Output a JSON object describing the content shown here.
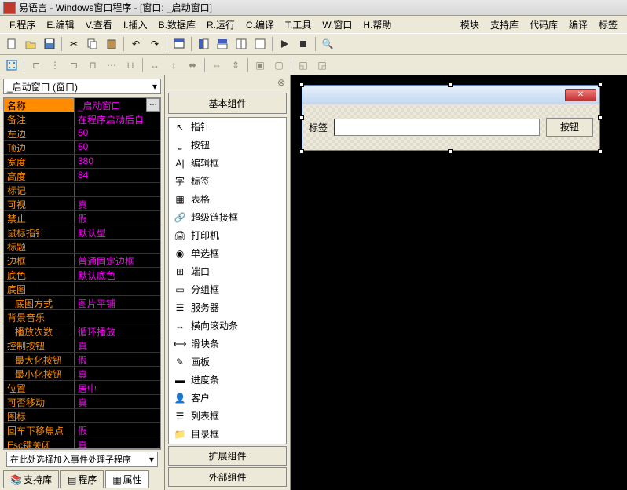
{
  "title": "易语言 - Windows窗口程序 - [窗口: _启动窗口]",
  "menu": {
    "left": [
      "F.程序",
      "E.编辑",
      "V.查看",
      "I.插入",
      "B.数据库",
      "R.运行",
      "C.编译",
      "T.工具",
      "W.窗口",
      "H.帮助"
    ],
    "right": [
      "模块",
      "支持库",
      "代码库",
      "编译",
      "标签"
    ]
  },
  "dropdown": "_启动窗口 (窗口)",
  "props": [
    {
      "name": "名称",
      "val": "_启动窗口",
      "sel": true,
      "btn": true
    },
    {
      "name": "备注",
      "val": "在程序启动后自"
    },
    {
      "name": "左边",
      "val": "50"
    },
    {
      "name": "顶边",
      "val": "50"
    },
    {
      "name": "宽度",
      "val": "380"
    },
    {
      "name": "高度",
      "val": "84"
    },
    {
      "name": "标记",
      "val": ""
    },
    {
      "name": "可视",
      "val": "真"
    },
    {
      "name": "禁止",
      "val": "假"
    },
    {
      "name": "鼠标指针",
      "val": "默认型"
    },
    {
      "name": "标题",
      "val": ""
    },
    {
      "name": "边框",
      "val": "普通固定边框"
    },
    {
      "name": "底色",
      "val": "默认底色"
    },
    {
      "name": "底图",
      "val": ""
    },
    {
      "name": "底图方式",
      "val": "图片平铺",
      "indent": true
    },
    {
      "name": "背景音乐",
      "val": ""
    },
    {
      "name": "播放次数",
      "val": "循环播放",
      "indent": true
    },
    {
      "name": "控制按钮",
      "val": "真"
    },
    {
      "name": "最大化按钮",
      "val": "假",
      "indent": true
    },
    {
      "name": "最小化按钮",
      "val": "真",
      "indent": true
    },
    {
      "name": "位置",
      "val": "居中"
    },
    {
      "name": "可否移动",
      "val": "真"
    },
    {
      "name": "图标",
      "val": ""
    },
    {
      "name": "回车下移焦点",
      "val": "假"
    },
    {
      "name": "Esc键关闭",
      "val": "真"
    }
  ],
  "event_dd": "在此处选择加入事件处理子程序",
  "tabs": [
    "支持库",
    "程序",
    "属性"
  ],
  "mid_head": "基本组件",
  "components": [
    {
      "icon": "↖",
      "label": "指针"
    },
    {
      "icon": "⎵",
      "label": "按钮"
    },
    {
      "icon": "A|",
      "label": "编辑框"
    },
    {
      "icon": "字",
      "label": "标签"
    },
    {
      "icon": "▦",
      "label": "表格"
    },
    {
      "icon": "🔗",
      "label": "超级链接框"
    },
    {
      "icon": "🖨",
      "label": "打印机"
    },
    {
      "icon": "◉",
      "label": "单选框"
    },
    {
      "icon": "⊞",
      "label": "端口"
    },
    {
      "icon": "▭",
      "label": "分组框"
    },
    {
      "icon": "☰",
      "label": "服务器"
    },
    {
      "icon": "↔",
      "label": "横向滚动条"
    },
    {
      "icon": "⟷",
      "label": "滑块条"
    },
    {
      "icon": "✎",
      "label": "画板"
    },
    {
      "icon": "▬",
      "label": "进度条"
    },
    {
      "icon": "👤",
      "label": "客户"
    },
    {
      "icon": "☰",
      "label": "列表框"
    },
    {
      "icon": "📁",
      "label": "目录框"
    }
  ],
  "mid_buttons": [
    "扩展组件",
    "外部组件"
  ],
  "form": {
    "label": "标签",
    "button": "按钮"
  }
}
